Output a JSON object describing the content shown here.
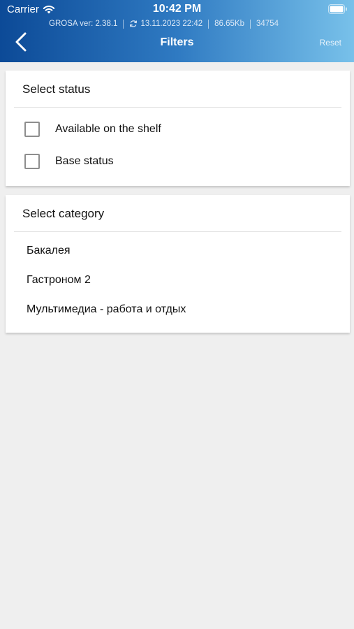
{
  "status_bar": {
    "carrier": "Carrier",
    "time": "10:42 PM",
    "wifi_icon": "wifi-icon",
    "battery_icon": "battery-icon"
  },
  "info_line": {
    "version": "GROSA ver: 2.38.1",
    "sync_datetime": "13.11.2023 22:42",
    "size": "86.65Kb",
    "count": "34754",
    "sync_icon": "sync-icon"
  },
  "nav": {
    "back_icon": "chevron-left-icon",
    "title": "Filters",
    "reset_label": "Reset"
  },
  "status_section": {
    "title": "Select status",
    "options": [
      {
        "label": "Available on the shelf",
        "checked": false
      },
      {
        "label": "Base status",
        "checked": false
      }
    ]
  },
  "category_section": {
    "title": "Select category",
    "items": [
      "Бакалея",
      "Гастроном 2",
      "Мультимедиа - работа и отдых"
    ]
  },
  "colors": {
    "header_gradient_start": "#0c4a97",
    "header_gradient_end": "#78c1ea",
    "background": "#efefef",
    "card": "#ffffff"
  }
}
